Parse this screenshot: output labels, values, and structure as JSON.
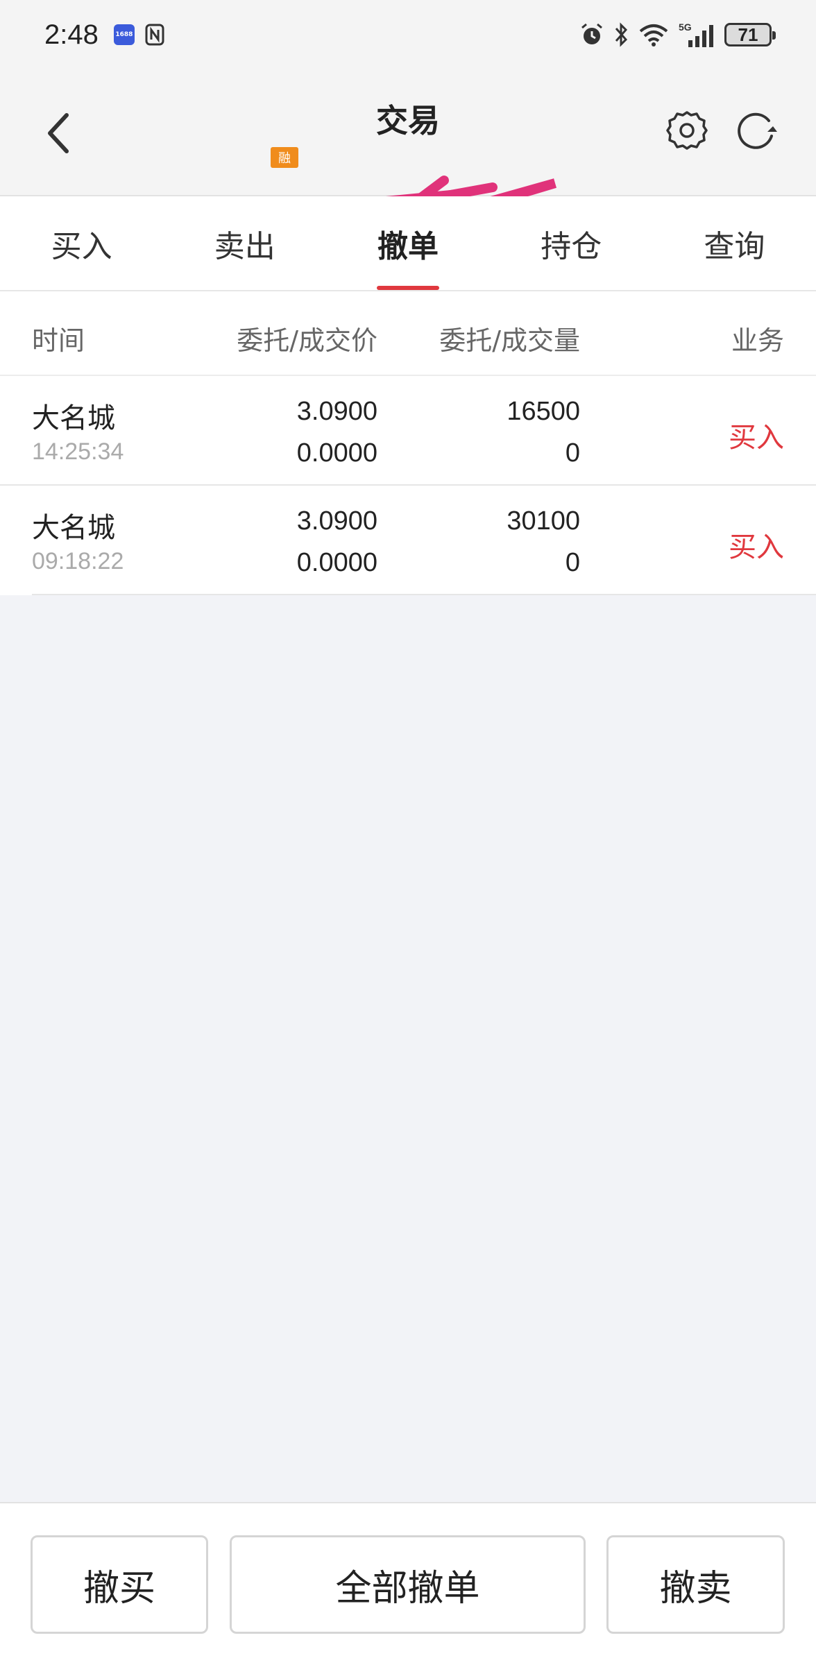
{
  "status_bar": {
    "time": "2:48",
    "app_badge_text": "1688",
    "battery_level": "71",
    "network_label": "5G"
  },
  "header": {
    "title": "交易",
    "account_badge": "融"
  },
  "tabs": [
    {
      "label": "买入",
      "active": false
    },
    {
      "label": "卖出",
      "active": false
    },
    {
      "label": "撤单",
      "active": true
    },
    {
      "label": "持仓",
      "active": false
    },
    {
      "label": "查询",
      "active": false
    }
  ],
  "columns": {
    "time": "时间",
    "price": "委托/成交价",
    "qty": "委托/成交量",
    "business": "业务"
  },
  "orders": [
    {
      "name": "大名城",
      "time": "14:25:34",
      "order_price": "3.0900",
      "deal_price": "0.0000",
      "order_qty": "16500",
      "deal_qty": "0",
      "business": "买入"
    },
    {
      "name": "大名城",
      "time": "09:18:22",
      "order_price": "3.0900",
      "deal_price": "0.0000",
      "order_qty": "30100",
      "deal_qty": "0",
      "business": "买入"
    }
  ],
  "actions": {
    "cancel_buy": "撤买",
    "cancel_all": "全部撤单",
    "cancel_sell": "撤卖"
  },
  "colors": {
    "accent_red": "#e0383e",
    "redaction_pink": "#e0327a"
  }
}
